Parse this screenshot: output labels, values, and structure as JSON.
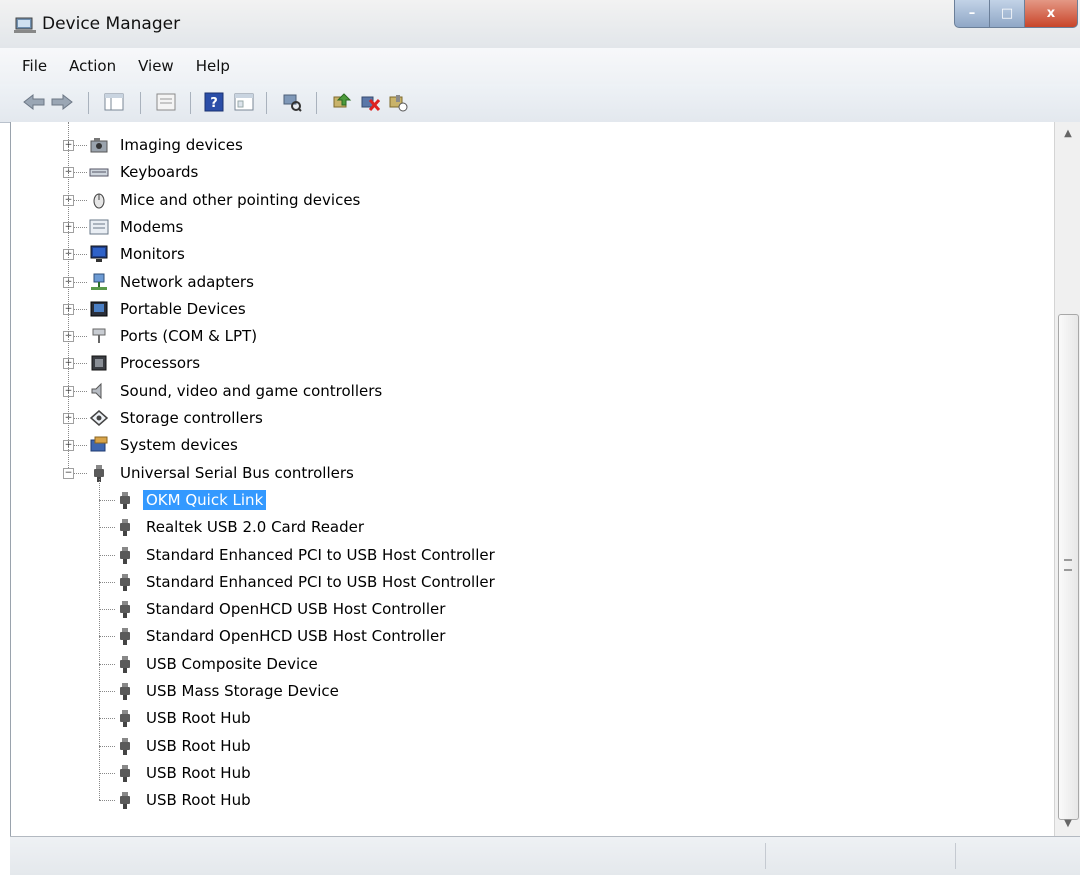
{
  "window": {
    "title": "Device Manager",
    "controls": {
      "minimize": "–",
      "maximize": "□",
      "close": "x"
    }
  },
  "menu": [
    "File",
    "Action",
    "View",
    "Help"
  ],
  "toolbar": [
    "back-icon",
    "forward-icon",
    "console-tree-icon",
    "properties-icon",
    "help-icon",
    "view-icon",
    "scan-hardware-icon",
    "update-driver-icon",
    "uninstall-device-icon",
    "disable-device-icon"
  ],
  "tree": {
    "categories": [
      {
        "label": "Imaging devices",
        "icon": "imaging-devices-icon",
        "expanded": false
      },
      {
        "label": "Keyboards",
        "icon": "keyboard-icon",
        "expanded": false
      },
      {
        "label": "Mice and other pointing devices",
        "icon": "mouse-icon",
        "expanded": false
      },
      {
        "label": "Modems",
        "icon": "modem-icon",
        "expanded": false
      },
      {
        "label": "Monitors",
        "icon": "monitor-icon",
        "expanded": false
      },
      {
        "label": "Network adapters",
        "icon": "network-adapter-icon",
        "expanded": false
      },
      {
        "label": "Portable Devices",
        "icon": "portable-device-icon",
        "expanded": false
      },
      {
        "label": "Ports (COM & LPT)",
        "icon": "port-icon",
        "expanded": false
      },
      {
        "label": "Processors",
        "icon": "processor-icon",
        "expanded": false
      },
      {
        "label": "Sound, video and game controllers",
        "icon": "speaker-icon",
        "expanded": false
      },
      {
        "label": "Storage controllers",
        "icon": "storage-controller-icon",
        "expanded": false
      },
      {
        "label": "System devices",
        "icon": "system-device-icon",
        "expanded": false
      },
      {
        "label": "Universal Serial Bus controllers",
        "icon": "usb-icon",
        "expanded": true
      }
    ],
    "usb_children": [
      {
        "label": "OKM Quick Link",
        "selected": true
      },
      {
        "label": "Realtek USB 2.0 Card Reader"
      },
      {
        "label": "Standard Enhanced PCI to USB Host Controller"
      },
      {
        "label": "Standard Enhanced PCI to USB Host Controller"
      },
      {
        "label": "Standard OpenHCD USB Host Controller"
      },
      {
        "label": "Standard OpenHCD USB Host Controller"
      },
      {
        "label": "USB Composite Device"
      },
      {
        "label": "USB Mass Storage Device"
      },
      {
        "label": "USB Root Hub"
      },
      {
        "label": "USB Root Hub"
      },
      {
        "label": "USB Root Hub"
      },
      {
        "label": "USB Root Hub"
      }
    ]
  },
  "status_bar": {
    "text": ""
  },
  "colors": {
    "selection": "#3399ff",
    "close_button": "#c8452a",
    "usb_icon": "#555555"
  }
}
